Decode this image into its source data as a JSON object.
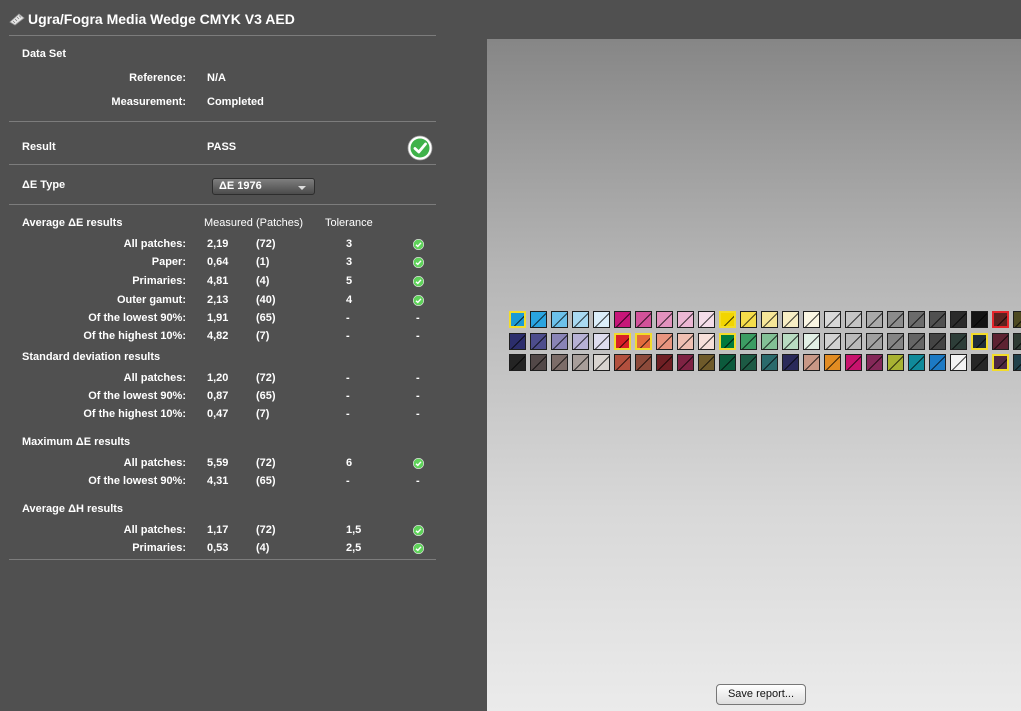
{
  "window": {
    "title": "Ugra/Fogra Media Wedge CMYK V3 AED",
    "icon": "ruler-icon"
  },
  "data_set": {
    "heading": "Data Set",
    "reference_label": "Reference:",
    "reference_value": "N/A",
    "measurement_label": "Measurement:",
    "measurement_value": "Completed"
  },
  "result": {
    "label": "Result",
    "value": "PASS",
    "icon": "check-circle-icon"
  },
  "de_type": {
    "label": "ΔE Type",
    "selected": "ΔE 1976"
  },
  "columns": {
    "measured": "Measured (Patches)",
    "tolerance": "Tolerance"
  },
  "avg_de": {
    "heading": "Average ΔE results",
    "rows": [
      {
        "label": "All patches:",
        "value": "2,19",
        "patches": "(72)",
        "tolerance": "3",
        "status": "ok"
      },
      {
        "label": "Paper:",
        "value": "0,64",
        "patches": "(1)",
        "tolerance": "3",
        "status": "ok"
      },
      {
        "label": "Primaries:",
        "value": "4,81",
        "patches": "(4)",
        "tolerance": "5",
        "status": "ok"
      },
      {
        "label": "Outer gamut:",
        "value": "2,13",
        "patches": "(40)",
        "tolerance": "4",
        "status": "ok"
      },
      {
        "label": "Of the lowest 90%:",
        "value": "1,91",
        "patches": "(65)",
        "tolerance": "-",
        "status": "-"
      },
      {
        "label": "Of the highest 10%:",
        "value": "4,82",
        "patches": "(7)",
        "tolerance": "-",
        "status": "-"
      }
    ]
  },
  "std_dev": {
    "heading": "Standard deviation results",
    "rows": [
      {
        "label": "All patches:",
        "value": "1,20",
        "patches": "(72)",
        "tolerance": "-",
        "status": "-"
      },
      {
        "label": "Of the lowest 90%:",
        "value": "0,87",
        "patches": "(65)",
        "tolerance": "-",
        "status": "-"
      },
      {
        "label": "Of the highest 10%:",
        "value": "0,47",
        "patches": "(7)",
        "tolerance": "-",
        "status": "-"
      }
    ]
  },
  "max_de": {
    "heading": "Maximum ΔE results",
    "rows": [
      {
        "label": "All patches:",
        "value": "5,59",
        "patches": "(72)",
        "tolerance": "6",
        "status": "ok"
      },
      {
        "label": "Of the lowest 90%:",
        "value": "4,31",
        "patches": "(65)",
        "tolerance": "-",
        "status": "-"
      }
    ]
  },
  "avg_dh": {
    "heading": "Average ΔH results",
    "rows": [
      {
        "label": "All patches:",
        "value": "1,17",
        "patches": "(72)",
        "tolerance": "1,5",
        "status": "ok"
      },
      {
        "label": "Primaries:",
        "value": "0,53",
        "patches": "(4)",
        "tolerance": "2,5",
        "status": "ok"
      }
    ]
  },
  "colors": {
    "ok": "#5fd35a",
    "warn_border": "#f2dc2a",
    "fail_border": "#e4252b"
  },
  "patches": [
    [
      {
        "c": "#1b9ad6",
        "s": "warn"
      },
      {
        "c": "#2aa4e0"
      },
      {
        "c": "#6cc1ea"
      },
      {
        "c": "#a9d9f1"
      },
      {
        "c": "#dbeef9"
      },
      {
        "c": "#c71679"
      },
      {
        "c": "#d2529a"
      },
      {
        "c": "#e292bd"
      },
      {
        "c": "#ebb7d3"
      },
      {
        "c": "#f4dde9"
      },
      {
        "c": "#f2d500",
        "s": "warn"
      },
      {
        "c": "#f5dd4a"
      },
      {
        "c": "#f6e698"
      },
      {
        "c": "#f7eec4"
      },
      {
        "c": "#faf6e3"
      },
      {
        "c": "#d8d8d8"
      },
      {
        "c": "#c4c4c4"
      },
      {
        "c": "#a9a9a9"
      },
      {
        "c": "#8c8c8c"
      },
      {
        "c": "#6b6b6b"
      },
      {
        "c": "#505050"
      },
      {
        "c": "#2b2b2b"
      },
      {
        "c": "#141414"
      },
      {
        "c": "#5a2320",
        "s": "fail"
      },
      {
        "c": "#4e4a22"
      }
    ],
    [
      {
        "c": "#2c2e6c"
      },
      {
        "c": "#4d4d8c"
      },
      {
        "c": "#8984b6"
      },
      {
        "c": "#b7b1d5"
      },
      {
        "c": "#dedcee"
      },
      {
        "c": "#d81f26",
        "s": "warn"
      },
      {
        "c": "#e36b3c",
        "s": "warn"
      },
      {
        "c": "#e8957f"
      },
      {
        "c": "#efc0b2"
      },
      {
        "c": "#f6e0da"
      },
      {
        "c": "#007a3d",
        "s": "warn"
      },
      {
        "c": "#3c9c63"
      },
      {
        "c": "#82bf95"
      },
      {
        "c": "#b8dcc2"
      },
      {
        "c": "#e1f0e5"
      },
      {
        "c": "#d2d2d2"
      },
      {
        "c": "#bababa"
      },
      {
        "c": "#a0a0a0"
      },
      {
        "c": "#848484"
      },
      {
        "c": "#656565"
      },
      {
        "c": "#444444"
      },
      {
        "c": "#2d3d38"
      },
      {
        "c": "#1f2e3a",
        "s": "warn"
      },
      {
        "c": "#5d2231"
      },
      {
        "c": "#2f3b33"
      }
    ],
    [
      {
        "c": "#242424"
      },
      {
        "c": "#524848"
      },
      {
        "c": "#7c6c68"
      },
      {
        "c": "#a89e9a"
      },
      {
        "c": "#d8d4d0"
      },
      {
        "c": "#b2503e"
      },
      {
        "c": "#8c4a3a"
      },
      {
        "c": "#6f1f24"
      },
      {
        "c": "#7e2243"
      },
      {
        "c": "#6e5a2a"
      },
      {
        "c": "#0c5a3c"
      },
      {
        "c": "#1c5a44"
      },
      {
        "c": "#2a6a6c"
      },
      {
        "c": "#2a2a5a"
      },
      {
        "c": "#c89886"
      },
      {
        "c": "#e28c22"
      },
      {
        "c": "#c8136d"
      },
      {
        "c": "#842858"
      },
      {
        "c": "#a8b232"
      },
      {
        "c": "#108a9a"
      },
      {
        "c": "#1c7ac4"
      },
      {
        "c": "#f4f4f4"
      },
      {
        "c": "#262626"
      },
      {
        "c": "#4e2842",
        "s": "warn"
      },
      {
        "c": "#20404a"
      }
    ]
  ],
  "save_button": "Save report..."
}
